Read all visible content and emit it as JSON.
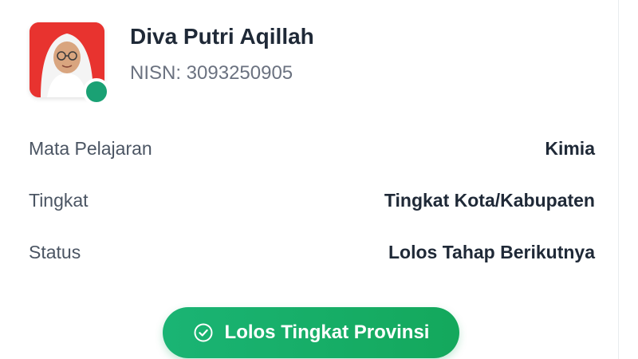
{
  "student": {
    "name": "Diva Putri Aqillah",
    "nisn": "NISN: 3093250905",
    "status_color": "#1aa174"
  },
  "details": [
    {
      "label": "Mata Pelajaran",
      "value": "Kimia"
    },
    {
      "label": "Tingkat",
      "value": "Tingkat Kota/Kabupaten"
    },
    {
      "label": "Status",
      "value": "Lolos Tahap Berikutnya"
    }
  ],
  "badge": {
    "label": "Lolos Tingkat Provinsi",
    "icon": "check-circle-icon",
    "color": "#1ab474"
  }
}
